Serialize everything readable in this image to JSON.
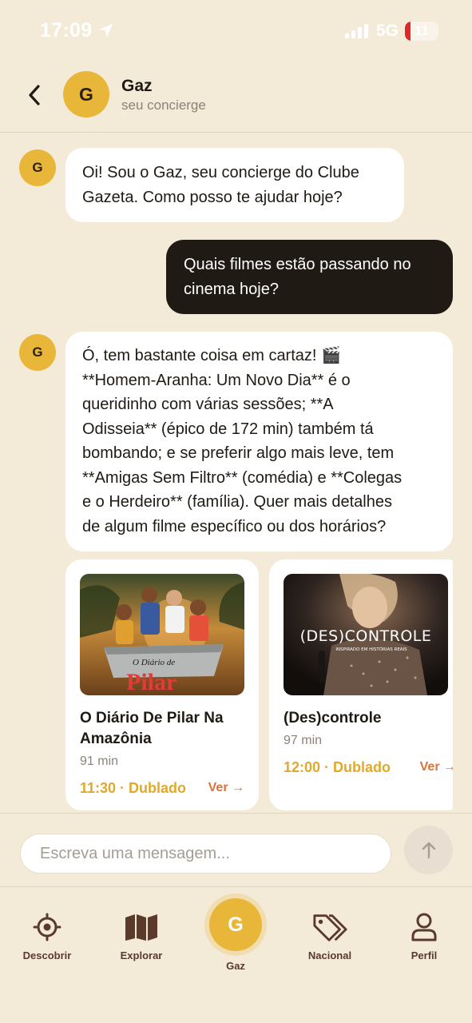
{
  "status_bar": {
    "time": "17:09",
    "network": "5G",
    "battery": "11"
  },
  "header": {
    "avatar_letter": "G",
    "name": "Gaz",
    "subtitle": "seu concierge"
  },
  "messages": [
    {
      "sender": "bot",
      "avatar_letter": "G",
      "lines": [
        "Oi! Sou o Gaz, seu concierge do Clube",
        "Gazeta. Como posso te ajudar hoje?"
      ]
    },
    {
      "sender": "user",
      "lines": [
        "Quais filmes estão passando no",
        "cinema hoje?"
      ]
    },
    {
      "sender": "bot",
      "avatar_letter": "G",
      "lines": [
        "Ó, tem bastante coisa em cartaz! 🎬",
        "**Homem-Aranha: Um Novo Dia** é o",
        "queridinho com várias sessões; **A",
        "Odisseia** (épico de 172 min) também tá",
        "bombando; e se preferir algo mais leve, tem",
        "**Amigas Sem Filtro** (comédia) e **Colegas",
        "e o Herdeiro** (família). Quer mais detalhes",
        "de algum filme específico ou dos horários?"
      ]
    }
  ],
  "movie_cards": [
    {
      "poster_title_line1": "O Diário de",
      "poster_title_line2": "Pilar",
      "title_line1": "O Diário De Pilar Na",
      "title_line2": "Amazônia",
      "duration": "91 min",
      "session": "11:30 · Dublado",
      "link": "Ver →"
    },
    {
      "poster_title": "(DES)CONTROLE",
      "poster_subtitle": "INSPIRADO EM HISTÓRIAS REAIS",
      "title": "(Des)controle",
      "duration": "97 min",
      "session": "12:00 · Dublado",
      "link": "Ver →"
    }
  ],
  "input": {
    "placeholder": "Escreva uma mensagem..."
  },
  "nav": {
    "items": [
      {
        "label": "Descobrir",
        "icon": "target-icon"
      },
      {
        "label": "Explorar",
        "icon": "map-icon"
      },
      {
        "label": "Gaz",
        "icon": "gaz-avatar",
        "letter": "G"
      },
      {
        "label": "Nacional",
        "icon": "tags-icon"
      },
      {
        "label": "Perfil",
        "icon": "user-icon"
      }
    ]
  },
  "colors": {
    "background": "#f4ead8",
    "accent": "#e8b638",
    "dark_bubble": "#1f1a14",
    "link": "#d8733a",
    "session": "#e0a92c"
  }
}
